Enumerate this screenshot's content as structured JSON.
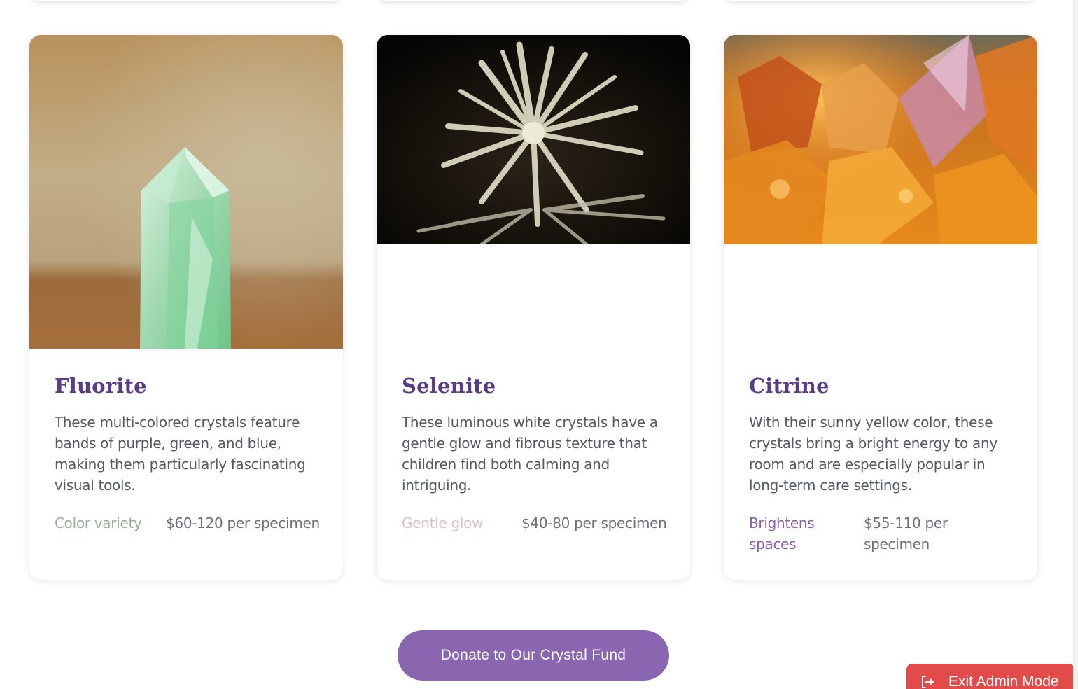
{
  "cards": [
    {
      "title": "Fluorite",
      "description": "These multi-colored crystals feature bands of purple, green, and blue, making them particularly fascinating visual tools.",
      "tag": "Color variety",
      "tag_color": "#9aae98",
      "price": "$60-120 per specimen"
    },
    {
      "title": "Selenite",
      "description": "These luminous white crystals have a gentle glow and fibrous texture that children find both calming and intriguing.",
      "tag": "Gentle glow",
      "tag_color": "#dcbfca",
      "price": "$40-80 per specimen"
    },
    {
      "title": "Citrine",
      "description": "With their sunny yellow color, these crystals bring a bright energy to any room and are especially popular in long-term care settings.",
      "tag": "Brightens spaces",
      "tag_color": "#8a5fb5",
      "price": "$55-110 per specimen"
    }
  ],
  "donate_button": {
    "label": "Donate to Our Crystal Fund",
    "color": "#8b66b0"
  },
  "admin_button": {
    "label": "Exit Admin Mode",
    "icon": "exit-icon",
    "color": "#e34b4b"
  },
  "colors": {
    "title": "#5a3b86",
    "body_text": "#555b66",
    "price_text": "#6b717c"
  }
}
